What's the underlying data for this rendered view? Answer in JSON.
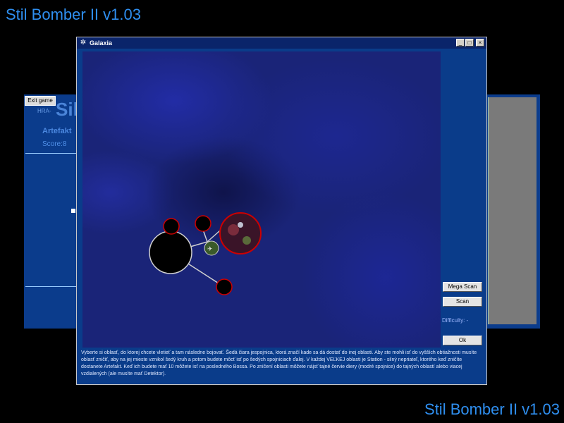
{
  "app": {
    "title": "Stil Bomber II v1.03",
    "title_bottom": "Stil Bomber II v1.03"
  },
  "background_window": {
    "exit_button": "Exit game",
    "hra_label": "HRA-",
    "big_title": "Sil",
    "artefakty_label": "Artefakt",
    "score": "Score:8"
  },
  "dialog": {
    "title": "Galaxia",
    "title_icon": "galaxy-icon",
    "window_buttons": {
      "minimize": "_",
      "maximize": "□",
      "close": "×"
    },
    "buttons": {
      "mega_scan": "Mega Scan",
      "scan": "Scan",
      "ok": "Ok"
    },
    "difficulty_label": "Difficulty: -",
    "description": "Vyberte si oblasť, do ktorej chcete vletieť a tam následne bojovať. Šedá čiara jespojnica, ktorá značí kade sa dá dostať do inej oblasti. Aby ste mohli isť do vyšších obtiažnosti musíte oblasť zničiť, aby na jej mieste vznikol šedý kruh a potom budete môcť isť po šedých spojniciach ďalej. V každej VEĽKEJ oblasti je Station - silný nepriateľ, ktorého keď zničíte dostanete Artefakt. Keď ich budete mať 10 môžete isť na posledného Bossa. Po zničení oblasti môžete nájsť tajné červie diery (modré spojnice) do tajných oblastí alebo viacej vzdialených (ale musíte mať Detektor).",
    "map_nodes": [
      {
        "name": "home-node",
        "kind": "destroyed-large"
      },
      {
        "name": "station-node",
        "kind": "large-active"
      },
      {
        "name": "small-node-1",
        "kind": "small"
      },
      {
        "name": "small-node-2",
        "kind": "small"
      },
      {
        "name": "small-node-3",
        "kind": "small"
      },
      {
        "name": "player-ship-node",
        "kind": "player"
      }
    ],
    "colors": {
      "node_border": "#cc0000",
      "link": "#cfcfcf",
      "dialog_bg": "#0a3c8a",
      "title_blue": "#2f8ff0"
    }
  }
}
